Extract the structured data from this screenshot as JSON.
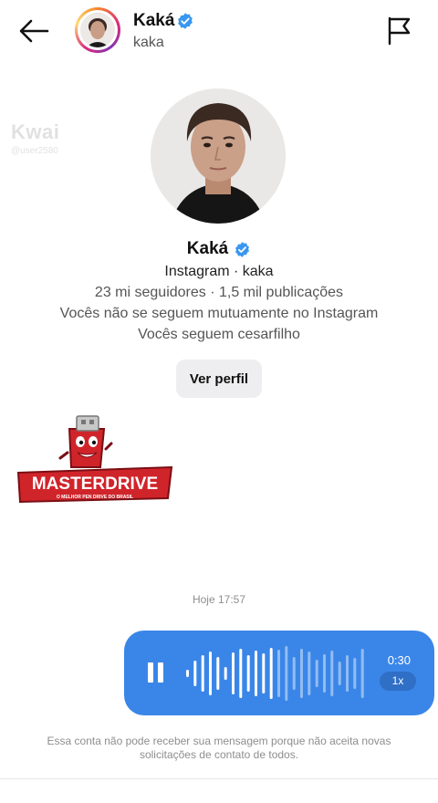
{
  "header": {
    "name": "Kaká",
    "username": "kaka",
    "icons": {
      "back": "arrow-left-icon",
      "report": "flag-icon",
      "verified": "verified-badge-icon"
    }
  },
  "watermark": {
    "logo": "Kwai",
    "handle": "@user2580"
  },
  "profile": {
    "name": "Kaká",
    "meta": "Instagram · kaka",
    "stats": "23 mi seguidores · 1,5 mil publicações",
    "mutual": "Vocês não se seguem mutuamente no Instagram",
    "follow": "Vocês seguem cesarfilho",
    "view_button": "Ver perfil"
  },
  "sponsor": {
    "brand": "MASTERDRIVE",
    "tagline": "O MELHOR PEN DRIVE DO BRASIL"
  },
  "conversation": {
    "timestamp": "Hoje 17:57",
    "voice_message": {
      "duration": "0:30",
      "speed": "1x",
      "played_fraction": 0.5
    },
    "notice": "Essa conta não pode receber sua mensagem porque não aceita novas solicitações de contato de todos."
  },
  "colors": {
    "bubble": "#3a86e8",
    "verified": "#3897f0",
    "sponsor_red": "#d0242b"
  }
}
